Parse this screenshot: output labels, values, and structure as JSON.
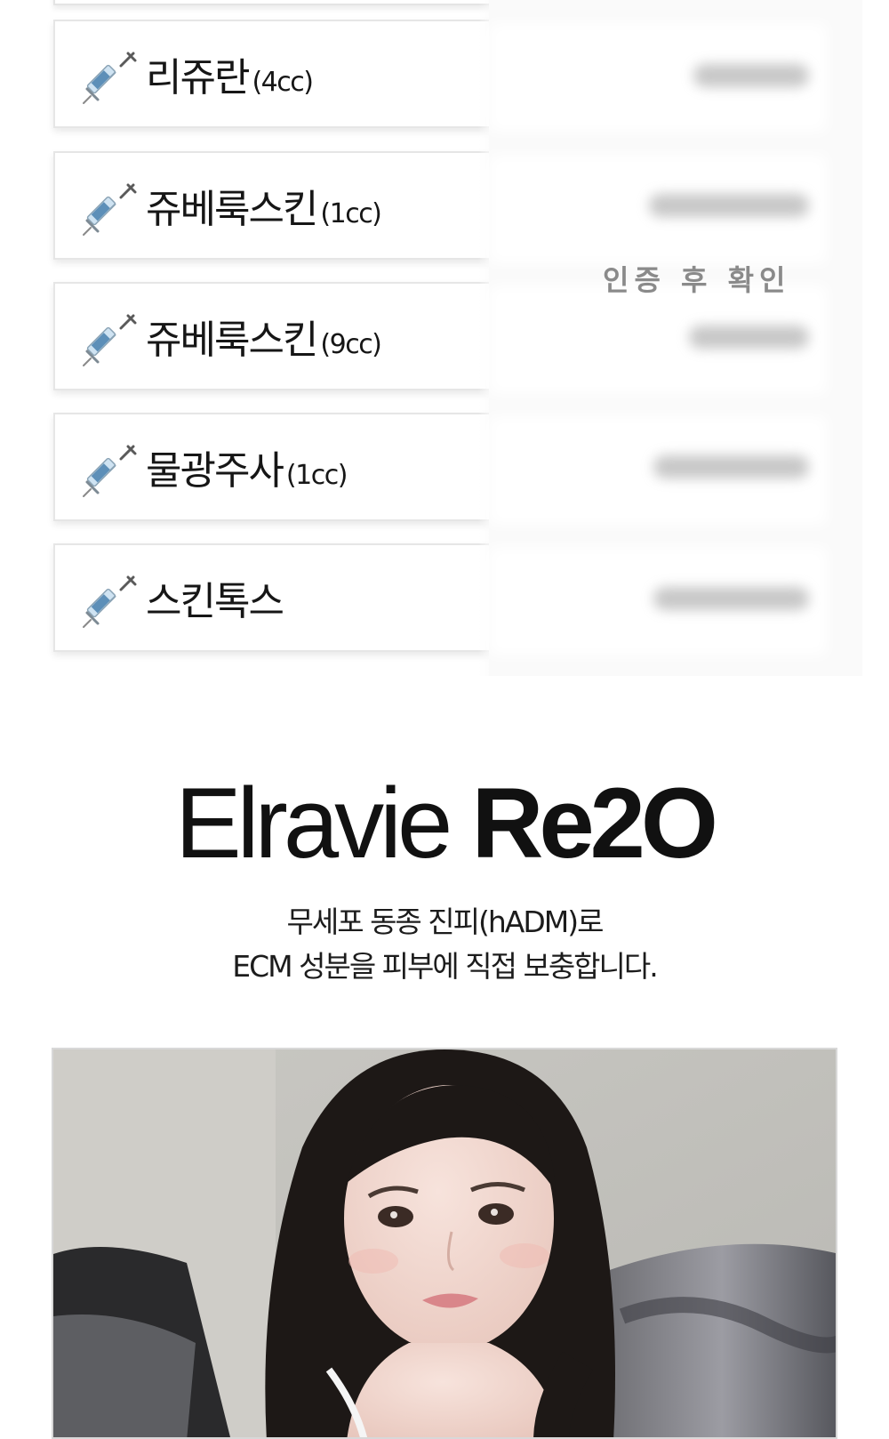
{
  "price_list": {
    "items": [
      {
        "name": "리쥬란",
        "volume": "(4cc)",
        "icon": "syringe-icon"
      },
      {
        "name": "쥬베룩스킨",
        "volume": "(1cc)",
        "icon": "syringe-icon"
      },
      {
        "name": "쥬베룩스킨",
        "volume": "(9cc)",
        "icon": "syringe-icon"
      },
      {
        "name": "물광주사",
        "volume": "(1cc)",
        "icon": "syringe-icon"
      },
      {
        "name": "스킨톡스",
        "volume": "",
        "icon": "syringe-icon"
      }
    ],
    "verify_note": "인증 후 확인"
  },
  "product": {
    "title_light": "Elravie ",
    "title_bold": "Re2O",
    "description_line1": "무세포 동종 진피(hADM)로",
    "description_line2": "ECM 성분을 피부에 직접 보충합니다."
  }
}
